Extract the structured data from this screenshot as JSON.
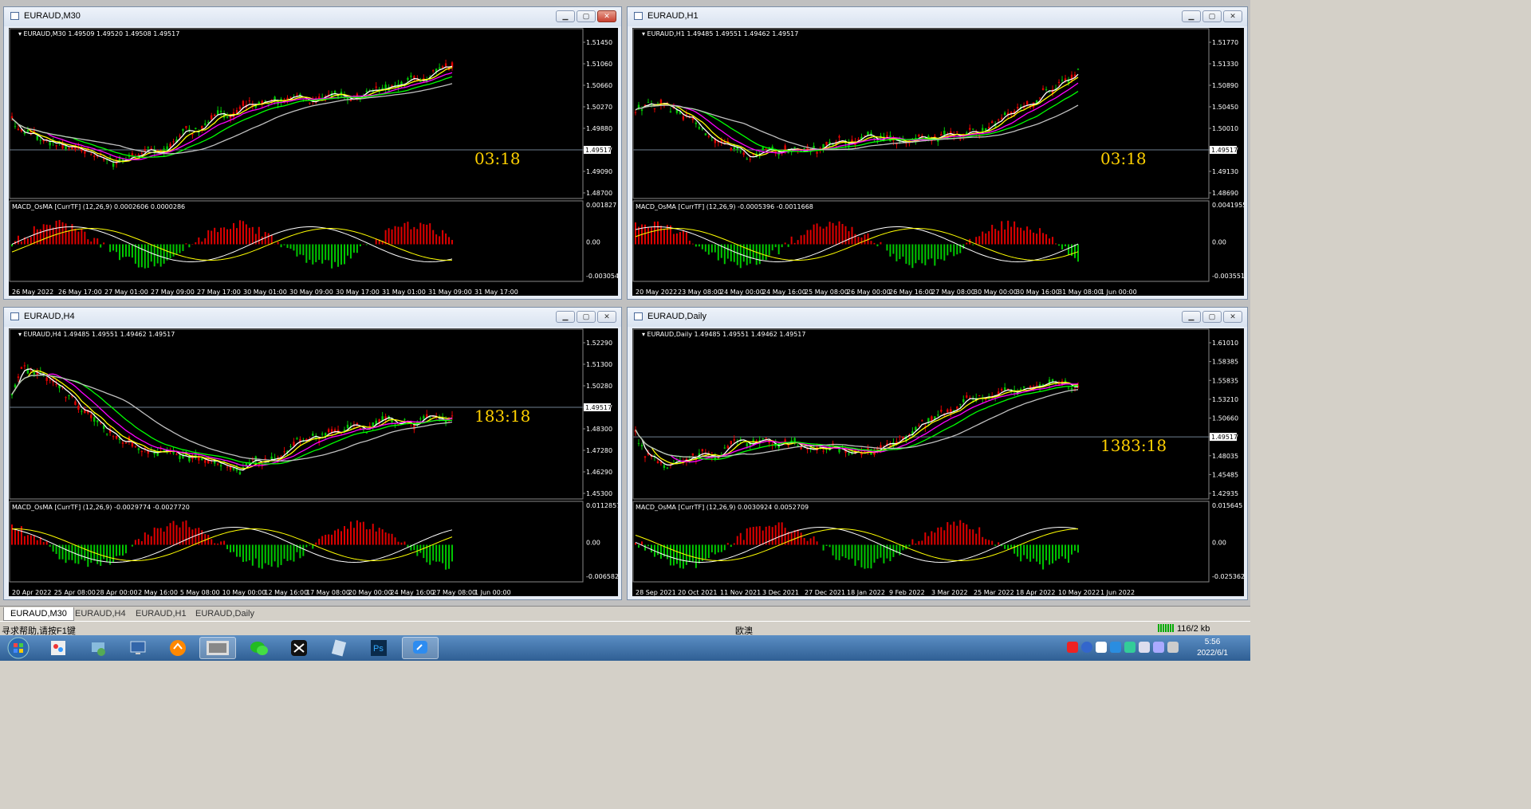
{
  "windows": [
    {
      "title": "EURAUD,M30",
      "info": "EURAUD,M30  1.49509 1.49520 1.49508 1.49517",
      "macd": "MACD_OsMA [CurrTF] (12,26,9) 0.0002606 0.0000286",
      "timer": "03:18",
      "prices": [
        "1.51450",
        "1.51060",
        "1.50660",
        "1.50270",
        "1.49880",
        "1.49517",
        "1.49090",
        "1.48700"
      ],
      "macd_scale": [
        "0.001827",
        "0.00",
        "-0.003054"
      ],
      "dates": [
        "26 May 2022",
        "26 May 17:00",
        "27 May 01:00",
        "27 May 09:00",
        "27 May 17:00",
        "30 May 01:00",
        "30 May 09:00",
        "30 May 17:00",
        "31 May 01:00",
        "31 May 09:00",
        "31 May 17:00"
      ]
    },
    {
      "title": "EURAUD,H1",
      "info": "EURAUD,H1  1.49485 1.49551 1.49462 1.49517",
      "macd": "MACD_OsMA [CurrTF] (12,26,9) -0.0005396 -0.0011668",
      "timer": "03:18",
      "prices": [
        "1.51770",
        "1.51330",
        "1.50890",
        "1.50450",
        "1.50010",
        "1.49517",
        "1.49130",
        "1.48690"
      ],
      "macd_scale": [
        "0.0041955",
        "0.00",
        "-0.003551"
      ],
      "dates": [
        "20 May 2022",
        "23 May 08:00",
        "24 May 00:00",
        "24 May 16:00",
        "25 May 08:00",
        "26 May 00:00",
        "26 May 16:00",
        "27 May 08:00",
        "30 May 00:00",
        "30 May 16:00",
        "31 May 08:00",
        "1 Jun 00:00"
      ]
    },
    {
      "title": "EURAUD,H4",
      "info": "EURAUD,H4  1.49485 1.49551 1.49462 1.49517",
      "macd": "MACD_OsMA [CurrTF] (12,26,9) -0.0029774 -0.0027720",
      "timer": "183:18",
      "prices": [
        "1.52290",
        "1.51300",
        "1.50280",
        "1.49517",
        "1.48300",
        "1.47280",
        "1.46290",
        "1.45300"
      ],
      "macd_scale": [
        "0.0112857",
        "0.00",
        "-0.006582"
      ],
      "dates": [
        "20 Apr 2022",
        "25 Apr 08:00",
        "28 Apr 00:00",
        "2 May 16:00",
        "5 May 08:00",
        "10 May 00:00",
        "12 May 16:00",
        "17 May 08:00",
        "20 May 00:00",
        "24 May 16:00",
        "27 May 08:00",
        "1 Jun 00:00"
      ]
    },
    {
      "title": "EURAUD,Daily",
      "info": "EURAUD,Daily  1.49485 1.49551 1.49462 1.49517",
      "macd": "MACD_OsMA [CurrTF] (12,26,9) 0.0030924 0.0052709",
      "timer": "1383:18",
      "prices": [
        "1.61010",
        "1.58385",
        "1.55835",
        "1.53210",
        "1.50660",
        "1.49517",
        "1.48035",
        "1.45485",
        "1.42935"
      ],
      "macd_scale": [
        "0.015645",
        "0.00",
        "-0.025362"
      ],
      "dates": [
        "28 Sep 2021",
        "20 Oct 2021",
        "11 Nov 2021",
        "3 Dec 2021",
        "27 Dec 2021",
        "18 Jan 2022",
        "9 Feb 2022",
        "3 Mar 2022",
        "25 Mar 2022",
        "18 Apr 2022",
        "10 May 2022",
        "1 Jun 2022"
      ]
    }
  ],
  "tabs": [
    "EURAUD,M30",
    "EURAUD,H4",
    "EURAUD,H1",
    "EURAUD,Daily"
  ],
  "status": {
    "help": "寻求帮助,请按F1键",
    "profile": "欧澳",
    "traffic": "116/2 kb"
  },
  "clock": {
    "time": "5:56",
    "date": "2022/6/1"
  },
  "colors": {
    "bull": "#00c800",
    "bear": "#e00000",
    "ma_fast": "#ffffff",
    "ma_mid": "#ffff00",
    "ma_slow": "#ff00ff",
    "ma_green": "#00ff00",
    "ma_grey": "#c0c0c0",
    "timer": "#ffd000"
  }
}
